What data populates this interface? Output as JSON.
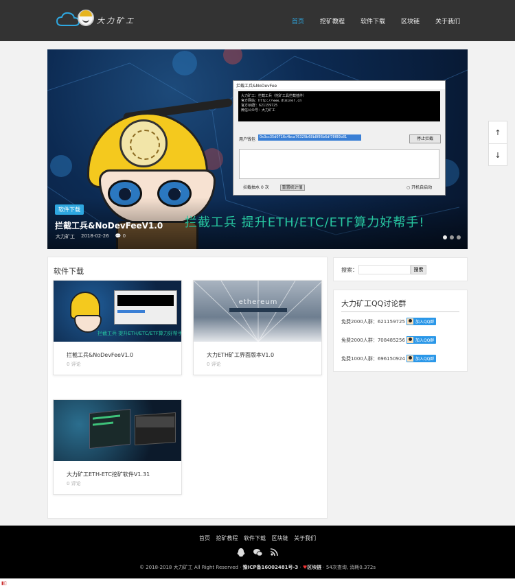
{
  "header": {
    "logo_text": "大力矿工",
    "nav": [
      "首页",
      "挖矿教程",
      "软件下载",
      "区块链",
      "关于我们"
    ],
    "active_index": 0,
    "accent_color": "#2ea7e0"
  },
  "banner": {
    "tag": "软件下载",
    "title": "拦截工兵&NoDevFeeV1.0",
    "author": "大力矿工",
    "date": "2018-02-26",
    "comments": "0",
    "slogan": "拦截工兵  提升ETH/ETC/ETF算力好帮手!",
    "slide_count": 3,
    "active_slide": 0,
    "app_window": {
      "title": "拦截工兵&NoDevFee",
      "console": "大力矿工：拦截工兵（挖矿工具拦截插件）\n官方网站：http://www.dlminer.cn\n官方QQ群：621159725\n微信公众号：大力矿工",
      "wallet_label": "用户钱包",
      "wallet_value": "0x3cc35d0716c4bca76329b68b8f86b6df78f80b81",
      "stop_button": "停止拦截",
      "intercept_label": "拦截抽水",
      "intercept_value": "0",
      "intercept_unit": "次",
      "reset_button": "重置统计值",
      "autostart_label": "开机自启动"
    }
  },
  "scroll": {
    "up_icon": "arrow-up-icon",
    "down_icon": "arrow-down-icon"
  },
  "main": {
    "section_title": "软件下载",
    "cards": [
      {
        "title": "拦截工兵&NoDevFeeV1.0",
        "comments": "0 评论",
        "img_caption": "拦截工兵  提升ETH/ETC/ETF算力好帮手!"
      },
      {
        "title": "大力ETH矿工界面版本V1.0",
        "comments": "0 评论",
        "img_caption": "ethereum"
      },
      {
        "title": "大力矿工ETH-ETC挖矿软件V1.31",
        "comments": "0 评论",
        "img_caption": ""
      }
    ]
  },
  "sidebar": {
    "search_label": "搜索：",
    "search_value": "",
    "search_button": "搜索",
    "qq_title": "大力矿工QQ讨论群",
    "qq_groups": [
      {
        "label": "免费2000人群：621159725",
        "button": "加入QQ群"
      },
      {
        "label": "免费2000人群：708485256",
        "button": "加入QQ群"
      },
      {
        "label": "免费1000人群：696150924",
        "button": "加入QQ群"
      }
    ]
  },
  "footer": {
    "nav": [
      "首页",
      "挖矿教程",
      "软件下载",
      "区块链",
      "关于我们"
    ],
    "icons": [
      "qq-icon",
      "wechat-icon",
      "rss-icon"
    ],
    "copyright": "© 2018-2018  大力矿工 All Right Reserved · ",
    "icp": "豫ICP备16002481号-3",
    "sep": " · ",
    "heart": "♥",
    "chain": "区块链",
    "stats": " · 54次查询, 消耗0.372s"
  }
}
